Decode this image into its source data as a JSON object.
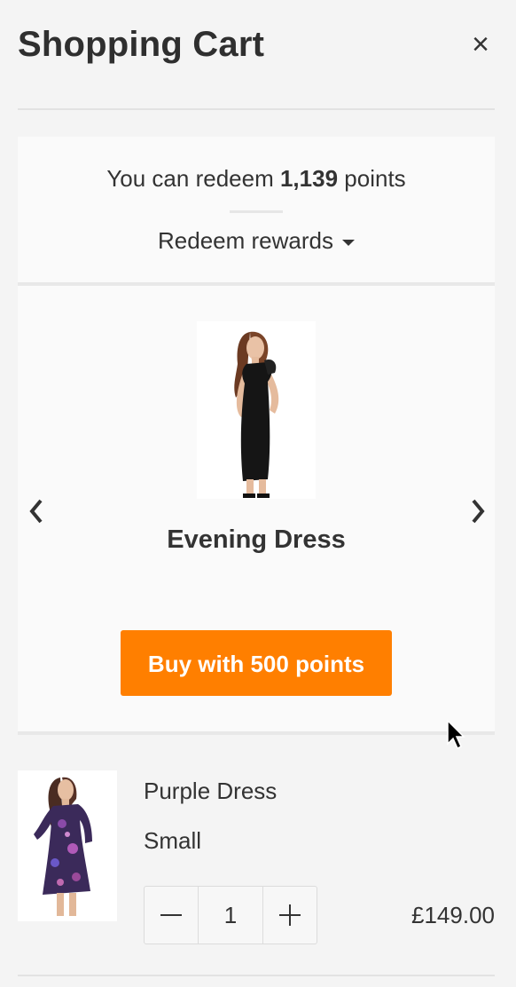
{
  "header": {
    "title": "Shopping Cart",
    "close_icon": "close-icon",
    "close_glyph": "×"
  },
  "points": {
    "prefix": "You can redeem",
    "amount": "1,139",
    "suffix": "points",
    "redeem_label": "Redeem rewards",
    "redeem_icon": "caret-down-icon"
  },
  "reward": {
    "name": "Evening Dress",
    "buy_label": "Buy with 500 points",
    "buy_color": "#ff7f00",
    "prev_icon": "chevron-left-icon",
    "next_icon": "chevron-right-icon"
  },
  "cart": {
    "items": [
      {
        "name": "Purple Dress",
        "size": "Small",
        "quantity": "1",
        "price": "£149.00",
        "minus_icon": "minus-icon",
        "plus_icon": "plus-icon"
      }
    ]
  },
  "colors": {
    "background": "#f4f4f4",
    "panel": "#fafafa",
    "text": "#333333",
    "accent": "#ff7f00"
  }
}
